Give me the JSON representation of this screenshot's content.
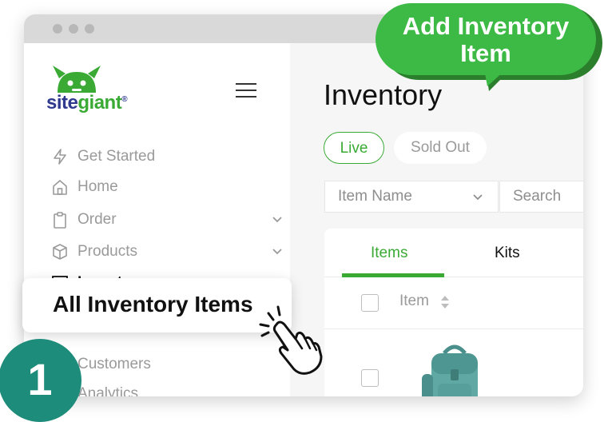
{
  "callout": {
    "text_line1": "Add Inventory",
    "text_line2": "Item"
  },
  "brand": {
    "part1": "site",
    "part2": "giant",
    "mark": "®"
  },
  "sidebar": {
    "items": [
      {
        "label": "Get Started",
        "icon": "bolt-icon"
      },
      {
        "label": "Home",
        "icon": "home-icon"
      },
      {
        "label": "Order",
        "icon": "clipboard-icon",
        "expandable": true
      },
      {
        "label": "Products",
        "icon": "box-icon",
        "expandable": true
      },
      {
        "label": "Inventory",
        "icon": "archive-icon",
        "expandable": true,
        "active": true
      },
      {
        "label": "Customers"
      },
      {
        "label": "Analytics"
      }
    ],
    "submenu_highlight": "All Inventory Items"
  },
  "main": {
    "title": "Inventory",
    "status_pills": [
      {
        "label": "Live",
        "selected": true
      },
      {
        "label": "Sold Out"
      }
    ],
    "filter": {
      "selected": "Item Name",
      "search_placeholder": "Search"
    },
    "tabs": [
      {
        "label": "Items",
        "selected": true
      },
      {
        "label": "Kits"
      }
    ],
    "table": {
      "column": "Item"
    }
  },
  "step": {
    "number": "1"
  },
  "colors": {
    "accent": "#3aaa35",
    "step_badge": "#1e8c7a",
    "brand_blue": "#2f3a8f"
  }
}
